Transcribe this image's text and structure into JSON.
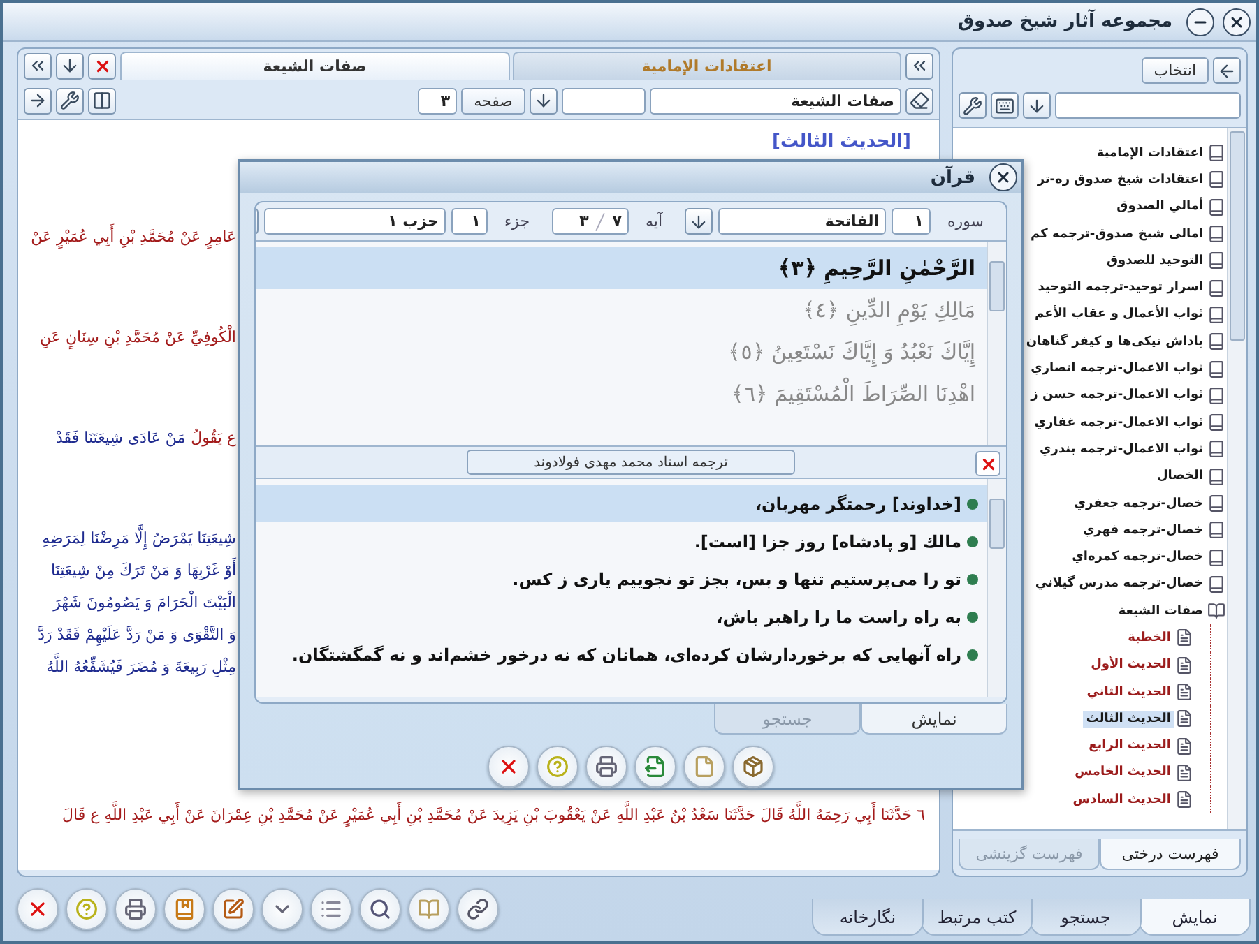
{
  "window": {
    "title": "مجموعه آثار شیخ صدوق"
  },
  "document_panel": {
    "tabs": [
      {
        "label": "اعتقادات الإمامية",
        "selected": false
      },
      {
        "label": "صفات الشيعة",
        "selected": true
      }
    ],
    "book_field": "صفات الشيعة",
    "page_label": "صفحه",
    "page_value": "۳",
    "heading": "[الحديث الثالث]",
    "paragraphs": [
      {
        "lines": [
          {
            "segments": [
              {
                "text": "عَامِرٍ عَنْ مُحَمَّدِ بْنِ أَبِي عُمَيْرٍ عَنْ",
                "color": "#a31b1b"
              }
            ]
          }
        ]
      },
      {
        "lines": [
          {
            "segments": [
              {
                "text": "الْكُوفِيِّ عَنْ مُحَمَّدِ بْنِ سِنَانٍ عَنِ",
                "color": "#a31b1b"
              }
            ]
          }
        ]
      },
      {
        "lines": [
          {
            "segments": [
              {
                "text": "ع يَقُولُ",
                "color": "#a31b1b"
              },
              {
                "text": "مَنْ عَادَى شِيعَتَنَا فَقَدْ",
                "color": "#1f2b8f"
              }
            ]
          }
        ]
      },
      {
        "lines": [
          {
            "segments": [
              {
                "text": "شِيعَتِنَا يَمْرَضُ إِلَّا مَرِضْنَا لِمَرَضِهِ",
                "color": "#1f2b8f"
              }
            ]
          },
          {
            "segments": [
              {
                "text": "أَوْ غَرْبِهَا وَ مَنْ تَرَكَ مِنْ شِيعَتِنَا",
                "color": "#1f2b8f"
              }
            ]
          },
          {
            "segments": [
              {
                "text": "الْبَيْتَ الْحَرَامَ وَ يَصُومُونَ شَهْرَ",
                "color": "#1f2b8f"
              }
            ]
          },
          {
            "segments": [
              {
                "text": "وَ التَّقْوَى وَ مَنْ رَدَّ عَلَيْهِمْ فَقَدْ رَدَّ",
                "color": "#1f2b8f"
              }
            ]
          },
          {
            "segments": [
              {
                "text": "مِثْلِ رَبِيعَةَ وَ مُضَرَ فَيُشَفِّعُهُ اللَّهُ",
                "color": "#1f2b8f"
              }
            ]
          }
        ]
      },
      {
        "lines": [
          {
            "segments": [
              {
                "text": "٦ حَدَّثَنَا أَبِي رَحِمَهُ اللَّهُ قَالَ حَدَّثَنَا سَعْدُ بْنُ عَبْدِ اللَّهِ عَنْ يَعْقُوبَ بْنِ يَزِيدَ عَنْ مُحَمَّدِ بْنِ أَبِي عُمَيْرٍ عَنْ مُحَمَّدِ بْنِ عِمْرَانَ عَنْ أَبِي عَبْدِ اللَّهِ ع قَالَ",
                "color": "#a31b1b"
              }
            ]
          }
        ]
      }
    ]
  },
  "sidebar": {
    "select_button": "انتخاب",
    "tree": [
      {
        "label": "اعتقادات الإمامية",
        "selected": false
      },
      {
        "label": "اعتقادات شيخ صدوق ره-تر",
        "selected": false
      },
      {
        "label": "أمالي الصدوق",
        "selected": false
      },
      {
        "label": "امالی شيخ صدوق-ترجمه كم",
        "selected": false
      },
      {
        "label": "التوحيد للصدوق",
        "selected": false
      },
      {
        "label": "اسرار توحيد-ترجمه التوحيد",
        "selected": false
      },
      {
        "label": "ثواب الأعمال و عقاب الأعم",
        "selected": false
      },
      {
        "label": "پاداش نيكی‌ها و كيفر گناهان",
        "selected": false
      },
      {
        "label": "ثواب الاعمال-ترجمه انصاري",
        "selected": false
      },
      {
        "label": "ثواب الاعمال-ترجمه حسن ز",
        "selected": false
      },
      {
        "label": "ثواب الاعمال-ترجمه غفاري",
        "selected": false
      },
      {
        "label": "ثواب الاعمال-ترجمه بندري",
        "selected": false
      },
      {
        "label": "الخصال",
        "selected": false
      },
      {
        "label": "خصال-ترجمه جعفري",
        "selected": false
      },
      {
        "label": "خصال-ترجمه فهري",
        "selected": false
      },
      {
        "label": "خصال-ترجمه كمره‌اي",
        "selected": false
      },
      {
        "label": "خصال-ترجمه مدرس گيلاني",
        "selected": false
      },
      {
        "label": "صفات الشيعة",
        "selected": false,
        "expanded": true,
        "children": [
          {
            "label": "الخطبة",
            "selected": false
          },
          {
            "label": "الحديث الأول",
            "selected": false
          },
          {
            "label": "الحديث الثاني",
            "selected": false
          },
          {
            "label": "الحديث الثالث",
            "selected": true
          },
          {
            "label": "الحديث الرابع",
            "selected": false
          },
          {
            "label": "الحديث الخامس",
            "selected": false
          },
          {
            "label": "الحديث السادس",
            "selected": false
          }
        ]
      }
    ],
    "tabs": [
      {
        "label": "فهرست درختی",
        "selected": true
      },
      {
        "label": "فهرست گزینشی",
        "selected": false
      }
    ]
  },
  "bottom_tabs": [
    {
      "label": "نمایش",
      "selected": true
    },
    {
      "label": "جستجو",
      "selected": false
    },
    {
      "label": "کتب مرتبط",
      "selected": false
    },
    {
      "label": "نگارخانه",
      "selected": false
    }
  ],
  "quran_dialog": {
    "title": "قرآن",
    "surah_label": "سوره",
    "surah_number": "۱",
    "surah_name": "الفاتحة",
    "ayah_label": "آيه",
    "ayah_total": "۷",
    "ayah_current": "۳",
    "juz_label": "جزء",
    "juz_value": "۱",
    "hizb_value": "حزب ۱",
    "verses": [
      {
        "text": "الرَّحْمٰنِ الرَّحِيمِ ﴿٣﴾",
        "selected": true
      },
      {
        "text": "مَالِكِ يَوْمِ الدِّينِ ﴿٤﴾",
        "selected": false
      },
      {
        "text": "إِيَّاكَ نَعْبُدُ وَ إِيَّاكَ نَسْتَعِينُ ﴿٥﴾",
        "selected": false
      },
      {
        "text": "اهْدِنَا الصِّرَاطَ الْمُسْتَقِيمَ ﴿٦﴾",
        "selected": false
      }
    ],
    "translation_title": "ترجمه استاد محمد مهدی فولادوند",
    "translations": [
      {
        "text": "[خداوند] رحمتگر مهربان،",
        "selected": true
      },
      {
        "text": "مالك [و پادشاه] روز جزا [است].",
        "selected": false
      },
      {
        "text": "تو را مى‌پرستيم تنها و بس، بجز تو نجوييم يارى ز كس.",
        "selected": false
      },
      {
        "text": "به راه راست ما را راهبر باش،",
        "selected": false
      },
      {
        "text": "راه آنهايى كه برخوردارشان كرده‌اى، همانان كه نه درخور خشم‌اند و نه گمگشتگان.",
        "selected": false
      }
    ],
    "tabs": [
      {
        "label": "نمایش",
        "selected": true
      },
      {
        "label": "جستجو",
        "selected": false
      }
    ]
  }
}
